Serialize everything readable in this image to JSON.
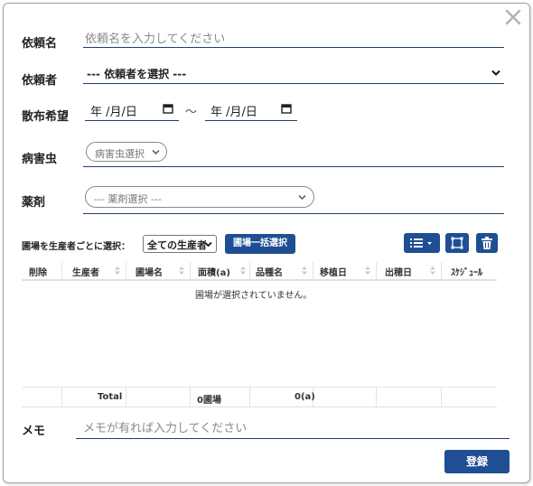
{
  "form": {
    "request_name_label": "依頼名",
    "request_name_placeholder": "依頼名を入力してください",
    "requester_label": "依頼者",
    "requester_value": "--- 依頼者を選択 ---",
    "spray_label": "散布希望",
    "date_from": "年 /月/日",
    "date_sep": "～",
    "date_to": "年 /月/日",
    "pest_label": "病害虫",
    "pest_select": "病害虫選択",
    "chem_label": "薬剤",
    "chem_select": "--- 薬剤選択 ---"
  },
  "field_select": {
    "label": "圃場を生産者ごとに選択：",
    "producer_option": "全ての生産者",
    "bulk_button": "圃場一括選択"
  },
  "table": {
    "headers": [
      "削除",
      "生産者",
      "圃場名",
      "面積(a)",
      "品種名",
      "移植日",
      "出穂日",
      "ｽｹｼﾞｭｰﾙ"
    ],
    "empty_message": "圃場が選択されていません。",
    "footer": {
      "total_label": "Total",
      "fields_count": "0圃場",
      "area_total": "0(a)"
    }
  },
  "memo": {
    "label": "メモ",
    "placeholder": "メモが有れば入力してください"
  },
  "submit_label": "登録",
  "colors": {
    "accent": "#1f4e93",
    "underline": "#1f3f6e",
    "border": "#9aa3ad"
  }
}
